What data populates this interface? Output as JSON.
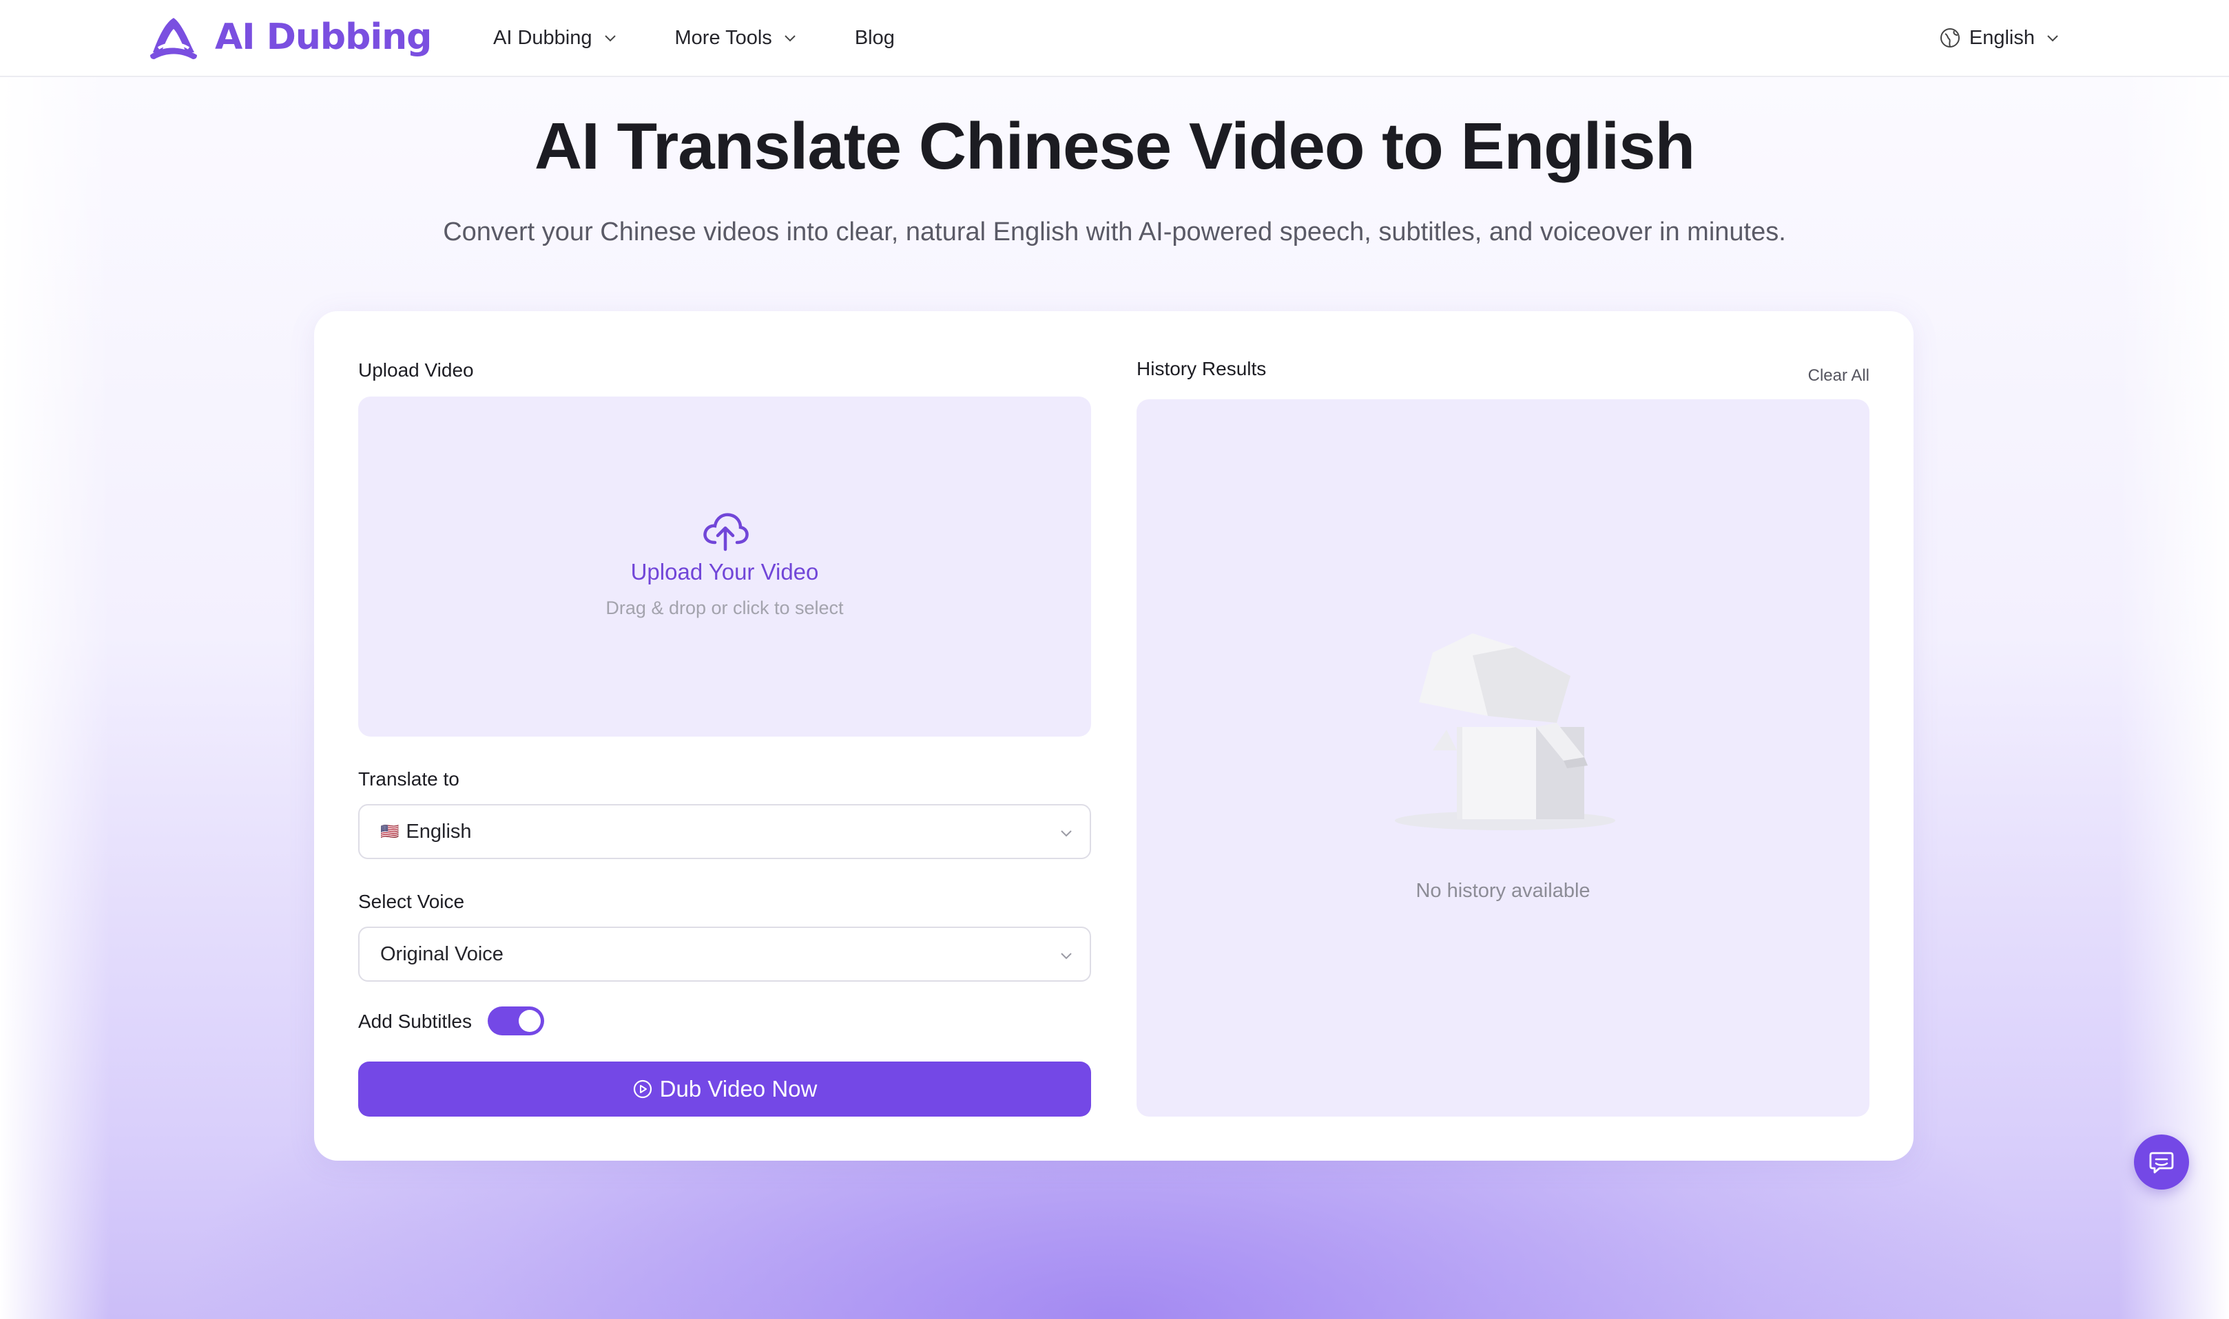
{
  "brand": {
    "name": "AI Dubbing",
    "color": "#7a4fe0"
  },
  "nav": {
    "items": [
      {
        "label": "AI Dubbing",
        "has_dropdown": true
      },
      {
        "label": "More Tools",
        "has_dropdown": true
      },
      {
        "label": "Blog",
        "has_dropdown": false
      }
    ],
    "language": "English"
  },
  "hero": {
    "title": "AI Translate Chinese Video to English",
    "subtitle": "Convert your Chinese videos into clear, natural English with AI-powered speech, subtitles, and voiceover in minutes."
  },
  "form": {
    "upload_label": "Upload Video",
    "upload_title": "Upload Your Video",
    "upload_hint": "Drag & drop or click to select",
    "translate_label": "Translate to",
    "translate_flag": "🇺🇸",
    "translate_value": "English",
    "voice_label": "Select Voice",
    "voice_value": "Original Voice",
    "subtitles_label": "Add Subtitles",
    "subtitles_enabled": true,
    "submit_label": "Dub Video Now"
  },
  "history": {
    "title": "History Results",
    "clear_label": "Clear All",
    "empty_text": "No history available"
  },
  "colors": {
    "accent": "#7448e6",
    "panel": "#efebfd"
  },
  "icons": [
    "upload-cloud-icon",
    "globe-icon",
    "chevron-down-icon",
    "play-circle-icon",
    "chat-support-icon",
    "empty-box-icon"
  ]
}
